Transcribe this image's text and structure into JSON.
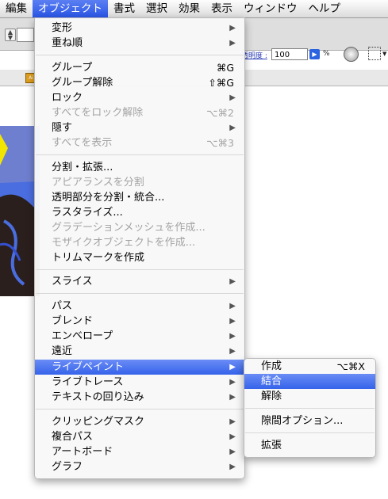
{
  "menubar": {
    "items": [
      {
        "label": "編集",
        "active": false
      },
      {
        "label": "オブジェクト",
        "active": true
      },
      {
        "label": "書式",
        "active": false
      },
      {
        "label": "選択",
        "active": false
      },
      {
        "label": "効果",
        "active": false
      },
      {
        "label": "表示",
        "active": false
      },
      {
        "label": "ウィンドウ",
        "active": false
      },
      {
        "label": "ヘルプ",
        "active": false
      }
    ]
  },
  "toolbar": {
    "opacity_label": "透明度 :",
    "opacity_value": "100",
    "percent_sign": "%",
    "gear_icon": "gear-icon",
    "grid_icon": "grid-icon"
  },
  "object_menu": {
    "items": [
      {
        "label": "変形",
        "shortcut": "",
        "submenu": true,
        "disabled": false
      },
      {
        "label": "重ね順",
        "shortcut": "",
        "submenu": true,
        "disabled": false
      },
      {
        "label": "グループ",
        "shortcut": "⌘G",
        "submenu": false,
        "disabled": false
      },
      {
        "label": "グループ解除",
        "shortcut": "⇧⌘G",
        "submenu": false,
        "disabled": false
      },
      {
        "label": "ロック",
        "shortcut": "",
        "submenu": true,
        "disabled": false
      },
      {
        "label": "すべてをロック解除",
        "shortcut": "⌥⌘2",
        "submenu": false,
        "disabled": true
      },
      {
        "label": "隠す",
        "shortcut": "",
        "submenu": true,
        "disabled": false
      },
      {
        "label": "すべてを表示",
        "shortcut": "⌥⌘3",
        "submenu": false,
        "disabled": true
      },
      {
        "label": "分割・拡張...",
        "shortcut": "",
        "submenu": false,
        "disabled": false
      },
      {
        "label": "アピアランスを分割",
        "shortcut": "",
        "submenu": false,
        "disabled": true
      },
      {
        "label": "透明部分を分割・統合...",
        "shortcut": "",
        "submenu": false,
        "disabled": false
      },
      {
        "label": "ラスタライズ...",
        "shortcut": "",
        "submenu": false,
        "disabled": false
      },
      {
        "label": "グラデーションメッシュを作成...",
        "shortcut": "",
        "submenu": false,
        "disabled": true
      },
      {
        "label": "モザイクオブジェクトを作成...",
        "shortcut": "",
        "submenu": false,
        "disabled": true
      },
      {
        "label": "トリムマークを作成",
        "shortcut": "",
        "submenu": false,
        "disabled": false
      },
      {
        "label": "スライス",
        "shortcut": "",
        "submenu": true,
        "disabled": false
      },
      {
        "label": "パス",
        "shortcut": "",
        "submenu": true,
        "disabled": false
      },
      {
        "label": "ブレンド",
        "shortcut": "",
        "submenu": true,
        "disabled": false
      },
      {
        "label": "エンベロープ",
        "shortcut": "",
        "submenu": true,
        "disabled": false
      },
      {
        "label": "遠近",
        "shortcut": "",
        "submenu": true,
        "disabled": false
      },
      {
        "label": "ライブペイント",
        "shortcut": "",
        "submenu": true,
        "disabled": false,
        "highlighted": true
      },
      {
        "label": "ライブトレース",
        "shortcut": "",
        "submenu": true,
        "disabled": false
      },
      {
        "label": "テキストの回り込み",
        "shortcut": "",
        "submenu": true,
        "disabled": false
      },
      {
        "label": "クリッピングマスク",
        "shortcut": "",
        "submenu": true,
        "disabled": false
      },
      {
        "label": "複合パス",
        "shortcut": "",
        "submenu": true,
        "disabled": false
      },
      {
        "label": "アートボード",
        "shortcut": "",
        "submenu": true,
        "disabled": false
      },
      {
        "label": "グラフ",
        "shortcut": "",
        "submenu": true,
        "disabled": false
      }
    ]
  },
  "livepaint_submenu": {
    "items": [
      {
        "label": "作成",
        "shortcut": "⌥⌘X",
        "disabled": false
      },
      {
        "label": "結合",
        "shortcut": "",
        "disabled": false,
        "highlighted": true
      },
      {
        "label": "解除",
        "shortcut": "",
        "disabled": false
      },
      {
        "label": "隙間オプション...",
        "shortcut": "",
        "disabled": false
      },
      {
        "label": "拡張",
        "shortcut": "",
        "disabled": false
      }
    ]
  },
  "colors": {
    "highlight": "#3563ea",
    "disabled_text": "#a3a3a3"
  }
}
